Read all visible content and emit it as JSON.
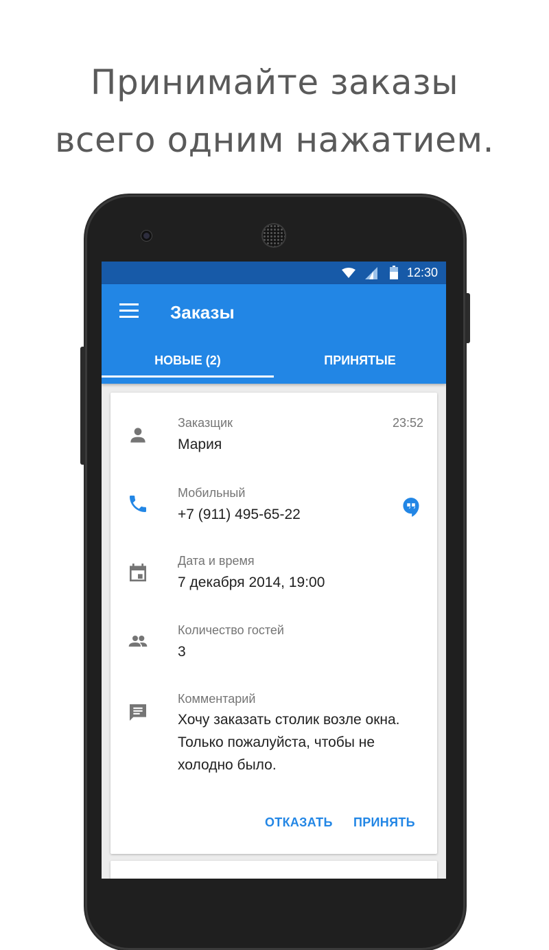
{
  "headline": {
    "line1": "Принимайте заказы",
    "line2": "всего одним нажатием."
  },
  "statusbar": {
    "time": "12:30",
    "icons": [
      "wifi-icon",
      "signal-icon",
      "battery-icon"
    ]
  },
  "appbar": {
    "title": "Заказы",
    "menu_icon": "menu-icon"
  },
  "tabs": [
    {
      "label": "НОВЫЕ (2)",
      "selected": true
    },
    {
      "label": "ПРИНЯТЫЕ",
      "selected": false
    }
  ],
  "order": {
    "customer": {
      "label": "Заказщик",
      "value": "Мария",
      "time": "23:52",
      "icon": "person-icon"
    },
    "phone": {
      "label": "Мобильный",
      "value": "+7 (911) 495-65-22",
      "icon": "phone-icon",
      "action_icon": "hangouts-icon"
    },
    "datetime": {
      "label": "Дата и время",
      "value": "7 декабря 2014, 19:00",
      "icon": "calendar-icon"
    },
    "guests": {
      "label": "Количество гостей",
      "value": "3",
      "icon": "people-icon"
    },
    "comment": {
      "label": "Комментарий",
      "value": "Хочу заказать столик возле окна. Только пожалуйста, чтобы не холодно было.",
      "icon": "comment-icon"
    }
  },
  "actions": {
    "decline": "ОТКАЗАТЬ",
    "accept": "ПРИНЯТЬ"
  },
  "colors": {
    "primary": "#2286e5",
    "primary_dark": "#175aa8",
    "icon_grey": "#757575"
  }
}
